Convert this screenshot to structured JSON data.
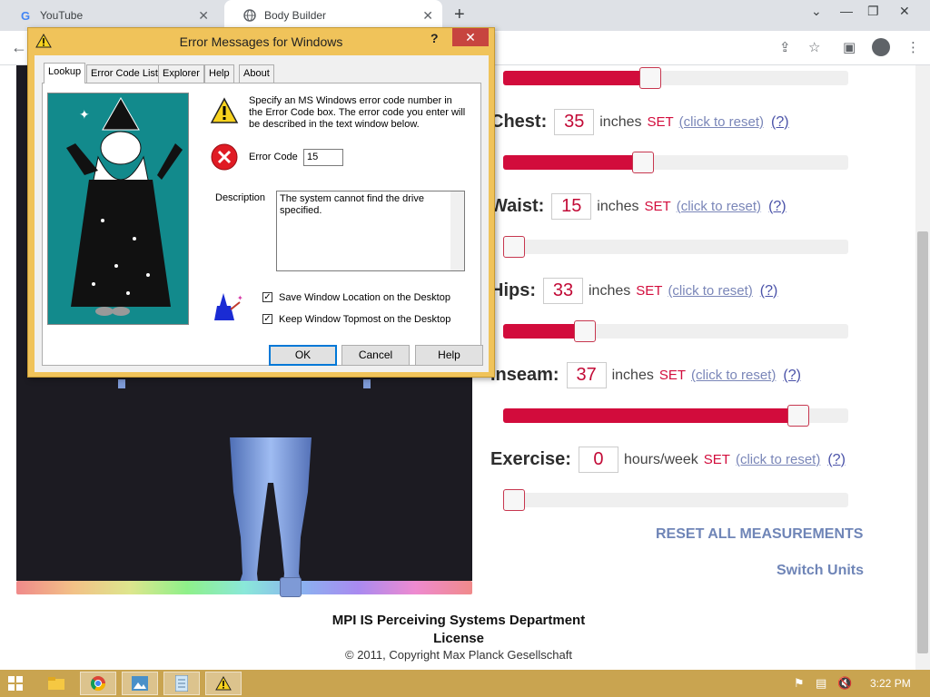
{
  "browser": {
    "tabs": [
      {
        "title": "YouTube",
        "icon": "google-icon"
      },
      {
        "title": "Body Builder",
        "icon": "globe-icon"
      }
    ],
    "new_tab": "+"
  },
  "dialog": {
    "title": "Error Messages for Windows",
    "help_glyph": "?",
    "close_glyph": "✕",
    "tabs": [
      "Lookup",
      "Error Code List",
      "Explorer",
      "Help",
      "About"
    ],
    "instructions": "Specify an MS Windows error code number in the Error Code box. The error code you enter will be described in the text window below.",
    "error_code_label": "Error Code",
    "error_code_value": "15",
    "description_label": "Description",
    "description_text": "The system cannot find the drive specified.",
    "checkboxes": [
      {
        "label": "Save Window Location on the Desktop",
        "checked": true
      },
      {
        "label": "Keep Window Topmost on the Desktop",
        "checked": true
      }
    ],
    "buttons": {
      "ok": "OK",
      "cancel": "Cancel",
      "help": "Help"
    }
  },
  "measurements": [
    {
      "label": "Chest:",
      "value": "35",
      "unit": "inches",
      "set": "SET",
      "reset": "(click to reset)",
      "q": "(?)",
      "slider_level": 0.4
    },
    {
      "label": "Waist:",
      "value": "15",
      "unit": "inches",
      "set": "SET",
      "reset": "(click to reset)",
      "q": "(?)",
      "slider_level": 0.0
    },
    {
      "label": "Hips:",
      "value": "33",
      "unit": "inches",
      "set": "SET",
      "reset": "(click to reset)",
      "q": "(?)",
      "slider_level": 0.22
    },
    {
      "label": "Inseam:",
      "value": "37",
      "unit": "inches",
      "set": "SET",
      "reset": "(click to reset)",
      "q": "(?)",
      "slider_level": 0.88
    },
    {
      "label": "Exercise:",
      "value": "0",
      "unit": "hours/week",
      "set": "SET",
      "reset": "(click to reset)",
      "q": "(?)",
      "slider_level": 0.0
    }
  ],
  "top_slider_level": 0.42,
  "reset_all": "RESET ALL MEASUREMENTS",
  "switch_units": "Switch Units",
  "footer": {
    "line1": "MPI IS Perceiving Systems Department",
    "line2": "License",
    "copyright": "© 2011, Copyright Max Planck Gesellschaft"
  },
  "taskbar": {
    "time": "3:22 PM"
  },
  "colors": {
    "accent": "#d20c3c",
    "link": "#6f85b7",
    "dialog_frame": "#f0c35a",
    "taskbar": "#c9a450"
  }
}
